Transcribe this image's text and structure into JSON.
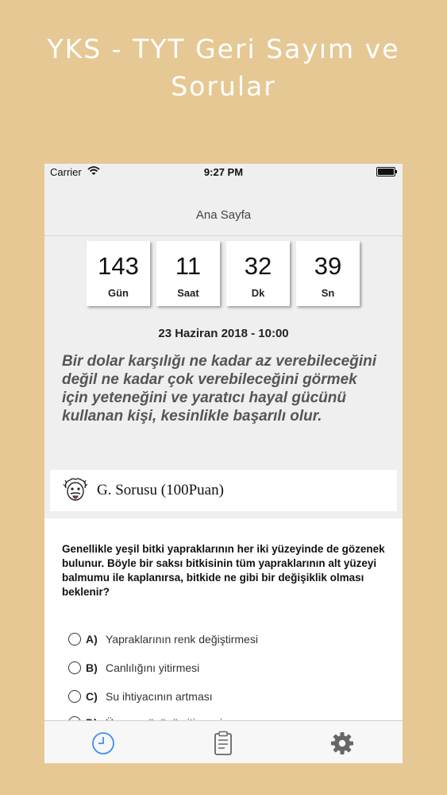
{
  "promo": {
    "title": "YKS - TYT Geri Sayım ve\nSorular"
  },
  "status": {
    "carrier": "Carrier",
    "time": "9:27 PM"
  },
  "nav": {
    "title": "Ana Sayfa"
  },
  "countdown": [
    {
      "value": "143",
      "unit": "Gün"
    },
    {
      "value": "11",
      "unit": "Saat"
    },
    {
      "value": "32",
      "unit": "Dk"
    },
    {
      "value": "39",
      "unit": "Sn"
    }
  ],
  "target_date": "23 Haziran 2018 - 10:00",
  "quote": "Bir dolar karşılığı ne kadar az verebileceğini değil ne kadar çok verebileceğini görmek için yeteneğini ve yaratıcı hayal gücünü kullanan kişi, kesinlikle başarılı olur.",
  "question": {
    "title": "G. Sorusu (100Puan)",
    "text": "Genellikle yeşil bitki yapraklarının her iki yüzeyinde de gözenek bulunur. Böyle bir saksı bitkisinin tüm yapraklarının alt yüzeyi balmumu ile kaplanırsa, bitkide ne gibi bir değişiklik olması beklenir?",
    "options": [
      {
        "letter": "A)",
        "text": "Yapraklarının renk değiştirmesi"
      },
      {
        "letter": "B)",
        "text": "Canlılığını yitirmesi"
      },
      {
        "letter": "C)",
        "text": "Su ihtiyacının artması"
      },
      {
        "letter": "D)",
        "text": "Üreme gücünü yitirmesi"
      }
    ]
  },
  "tabs": [
    {
      "icon": "clock-icon",
      "active": true
    },
    {
      "icon": "clipboard-icon",
      "active": false
    },
    {
      "icon": "gear-icon",
      "active": false
    }
  ],
  "colors": {
    "background": "#e6c894",
    "tab_active": "#3d8ff5",
    "tab_inactive": "#666666"
  }
}
